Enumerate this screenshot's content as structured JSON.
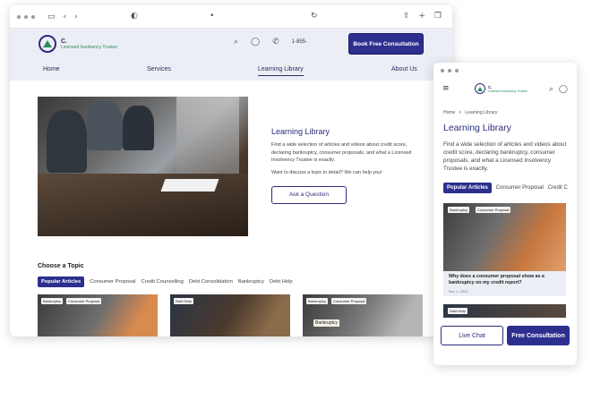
{
  "desktop": {
    "browser": {
      "icons": [
        "window-dots",
        "sidebar-icon",
        "back-icon",
        "forward-icon",
        "shield-icon",
        "lock-icon",
        "reload-icon",
        "share-icon",
        "new-tab-icon",
        "tabs-icon"
      ]
    },
    "header": {
      "logo_name": "C.",
      "logo_tagline": "Licensed Insolvency Trustee",
      "phone": "1-855-",
      "book_label": "Book Free Consultation"
    },
    "nav": {
      "items": [
        {
          "label": "Home"
        },
        {
          "label": "Services"
        },
        {
          "label": "Learning Library"
        },
        {
          "label": "About Us"
        }
      ],
      "active": "Learning Library"
    },
    "hero": {
      "title": "Learning Library",
      "description": "Find a wide selection of articles and videos about credit score, declaring bankruptcy, consumer proposals, and what a Licensed Insolvency Trustee is exactly.",
      "cta_text": "Want to discuss a topic in detail? We can help you!",
      "ask_label": "Ask a Question"
    },
    "topics": {
      "title": "Choose a Topic",
      "tabs": [
        "Popular Articles",
        "Consumer Proposal",
        "Credit Counselling",
        "Debt Consolidation",
        "Bankruptcy",
        "Debt Help"
      ]
    },
    "cards": [
      {
        "tags": [
          "Bankruptcy",
          "Consumer Proposal"
        ]
      },
      {
        "tags": [
          "Debt Help"
        ]
      },
      {
        "tags": [
          "Bankruptcy",
          "Consumer Proposal"
        ],
        "sign": "Bankruptcy"
      }
    ]
  },
  "mobile": {
    "breadcrumb": {
      "home": "Home",
      "sep": ">",
      "current": "Learning Library"
    },
    "title": "Learning Library",
    "description": "Find a wide selection of articles and videos about credit score, declaring bankruptcy, consumer proposals, and what a Licensed Insolvency Trustee is exactly.",
    "tabs": [
      "Popular Articles",
      "Consumer Proposal",
      "Credit C"
    ],
    "card": {
      "tags": [
        "Bankruptcy",
        "Consumer Proposal"
      ],
      "title": "Why does a consumer proposal show as a bankruptcy on my credit report?",
      "date": "Nov 1, 2021"
    },
    "card2_tag": "Debt Help",
    "live_chat_label": "Live Chat",
    "free_consult_label": "Free Consultation"
  },
  "colors": {
    "primary": "#2d2f8f",
    "accent_green": "#2e8b57",
    "header_bg": "#eceef5"
  }
}
